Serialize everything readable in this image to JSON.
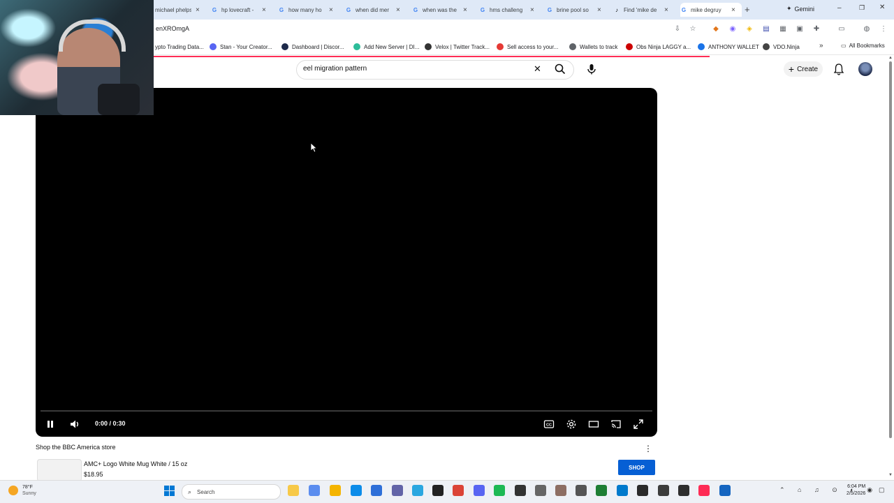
{
  "browser": {
    "tabs": [
      {
        "title": "michael phelps",
        "icon": "google-icon"
      },
      {
        "title": "hp lovecraft -",
        "icon": "google-icon"
      },
      {
        "title": "how many ho",
        "icon": "google-icon"
      },
      {
        "title": "when did mer",
        "icon": "google-icon"
      },
      {
        "title": "when was the",
        "icon": "google-icon"
      },
      {
        "title": "hms challeng",
        "icon": "google-icon"
      },
      {
        "title": "brine pool so",
        "icon": "google-icon"
      },
      {
        "title": "Find 'mike de",
        "icon": "tiktok-icon"
      },
      {
        "title": "mike degruy",
        "icon": "google-icon"
      }
    ],
    "gemini_label": "Gemini",
    "url_fragment": "enXROmgA",
    "bookmarks": [
      {
        "label": "ypto Trading Data...",
        "color": "#f0b90b"
      },
      {
        "label": "Stan - Your Creator...",
        "color": "#5865f2"
      },
      {
        "label": "Dashboard | Discor...",
        "color": "#1e2a4a"
      },
      {
        "label": "Add New Server | DI...",
        "color": "#2dbd9a"
      },
      {
        "label": "Velox | Twitter Track...",
        "color": "#333333"
      },
      {
        "label": "Sell access to your...",
        "color": "#e53935"
      },
      {
        "label": "Wallets to track",
        "color": "#5f6368"
      },
      {
        "label": "Obs Ninja LAGGY a...",
        "color": "#cc0000"
      },
      {
        "label": "ANTHONY WALLET",
        "color": "#1a73e8"
      },
      {
        "label": "VDO.Ninja",
        "color": "#444444"
      }
    ],
    "all_bookmarks": "All Bookmarks",
    "more_bookmarks": "»"
  },
  "youtube": {
    "search_query": "eel migration pattern",
    "create_label": "Create"
  },
  "player": {
    "time": "0:00 / 0:30",
    "progress_fraction": 0
  },
  "shop": {
    "title": "Shop the BBC America store",
    "product_name": "AMC+ Logo White Mug White / 15 oz",
    "product_price": "$18.95",
    "button": "SHOP"
  },
  "taskbar": {
    "weather_temp": "78°F",
    "weather_desc": "Sunny",
    "search_label": "Search",
    "time": "6:04 PM",
    "date": "2/5/2026"
  }
}
